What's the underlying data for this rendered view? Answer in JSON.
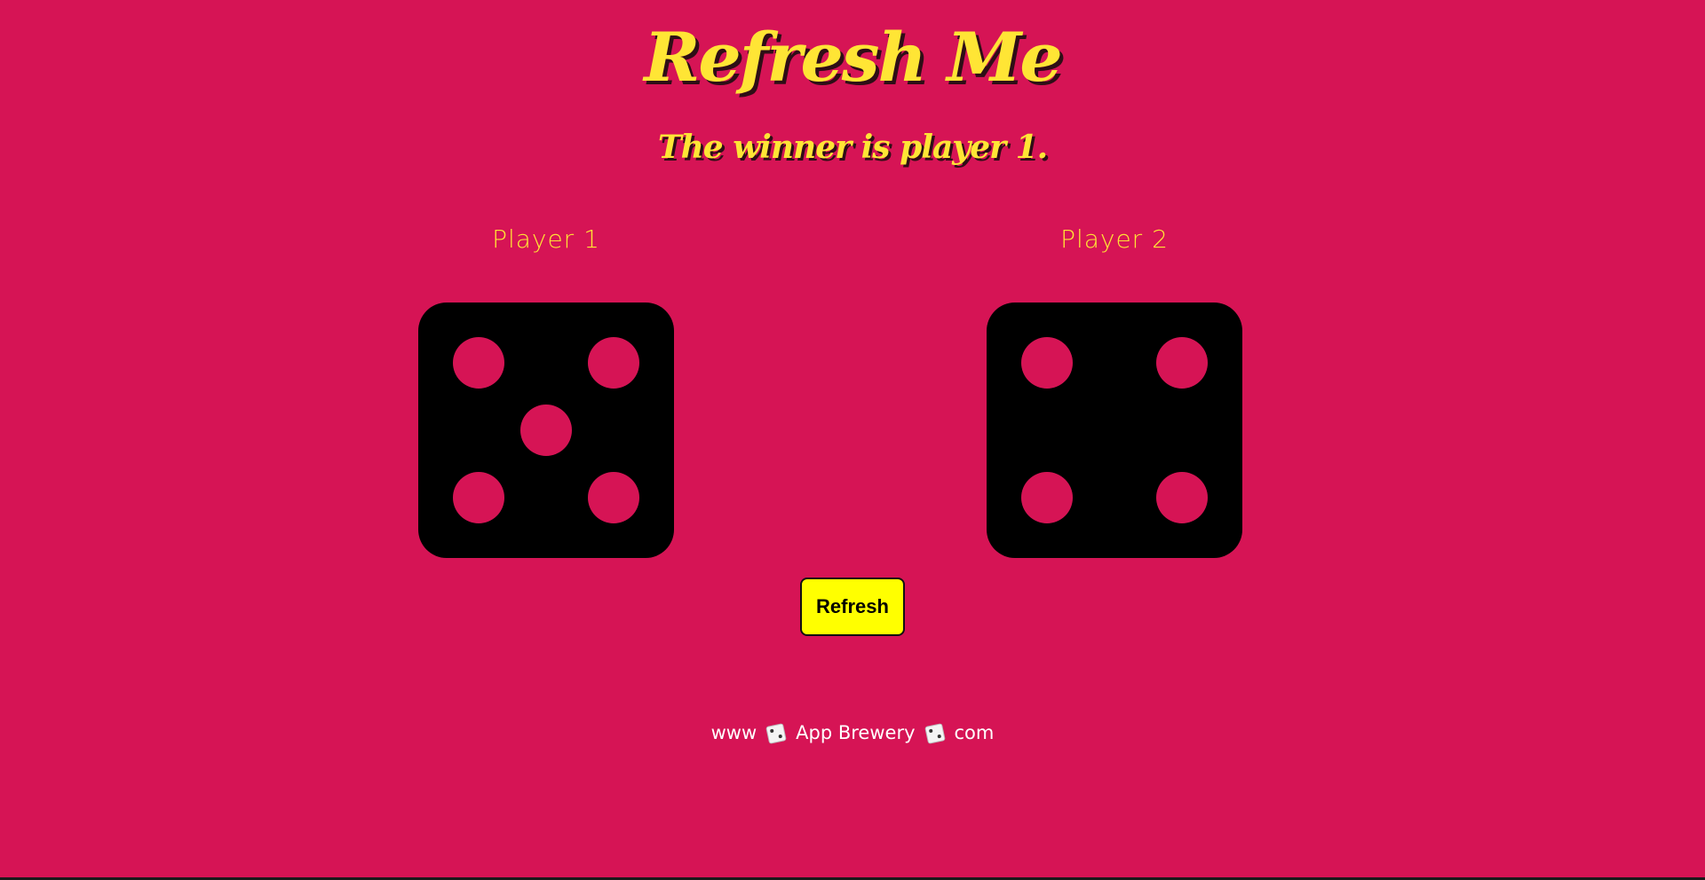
{
  "header": {
    "title": "Refresh Me",
    "result": "The winner is player 1."
  },
  "players": [
    {
      "label": "Player 1",
      "die_value": 5
    },
    {
      "label": "Player 2",
      "die_value": 4
    }
  ],
  "actions": {
    "refresh_label": "Refresh"
  },
  "footer": {
    "part1": "www",
    "part2": "App Brewery",
    "part3": "com",
    "icon": "die-icon"
  },
  "colors": {
    "background": "#d61455",
    "title": "#ffe535",
    "die": "#000000",
    "button": "#ffff00"
  }
}
